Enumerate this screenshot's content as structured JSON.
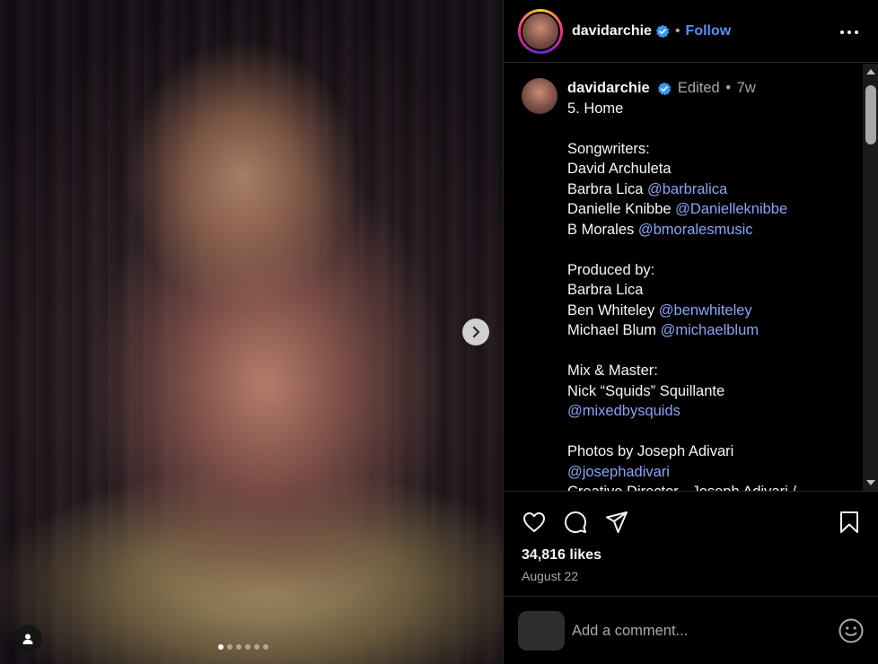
{
  "post": {
    "username": "davidarchie",
    "follow_label": "Follow",
    "separator": "•"
  },
  "caption": {
    "username": "davidarchie",
    "edited_label": "Edited",
    "separator": "•",
    "age": "7w",
    "lines": [
      {
        "text": "5. Home",
        "mention": ""
      },
      {
        "text": "",
        "mention": ""
      },
      {
        "text": "Songwriters:",
        "mention": ""
      },
      {
        "text": "David Archuleta",
        "mention": ""
      },
      {
        "text": "Barbra Lica ",
        "mention": "@barbralica"
      },
      {
        "text": "Danielle Knibbe ",
        "mention": "@Danielleknibbe"
      },
      {
        "text": "B Morales ",
        "mention": "@bmoralesmusic"
      },
      {
        "text": "",
        "mention": ""
      },
      {
        "text": "Produced by:",
        "mention": ""
      },
      {
        "text": "Barbra Lica",
        "mention": ""
      },
      {
        "text": "Ben Whiteley ",
        "mention": "@benwhiteley"
      },
      {
        "text": "Michael Blum ",
        "mention": "@michaelblum"
      },
      {
        "text": "",
        "mention": ""
      },
      {
        "text": "Mix & Master:",
        "mention": ""
      },
      {
        "text": "Nick “Squids” Squillante",
        "mention": ""
      },
      {
        "text": "",
        "mention": "@mixedbysquids"
      },
      {
        "text": "",
        "mention": ""
      },
      {
        "text": "Photos by Joseph Adivari",
        "mention": ""
      },
      {
        "text": "",
        "mention": "@josephadivari"
      },
      {
        "text": "Creative Director - Joseph Adivari /",
        "mention": ""
      }
    ]
  },
  "stats": {
    "likes": "34,816 likes",
    "date": "August 22"
  },
  "comment": {
    "placeholder": "Add a comment..."
  },
  "carousel": {
    "slide_count": 6,
    "active_index": 0
  },
  "icons": {
    "verified": "verified-badge-icon",
    "more": "more-options-icon",
    "like": "heart-icon",
    "comment": "comment-icon",
    "share": "share-icon",
    "save": "bookmark-icon",
    "emoji": "emoji-icon",
    "next": "chevron-right-icon",
    "tags": "user-tag-icon"
  },
  "colors": {
    "link": "#8aa4f5",
    "follow": "#5b8df6",
    "verified": "#3897f0"
  }
}
